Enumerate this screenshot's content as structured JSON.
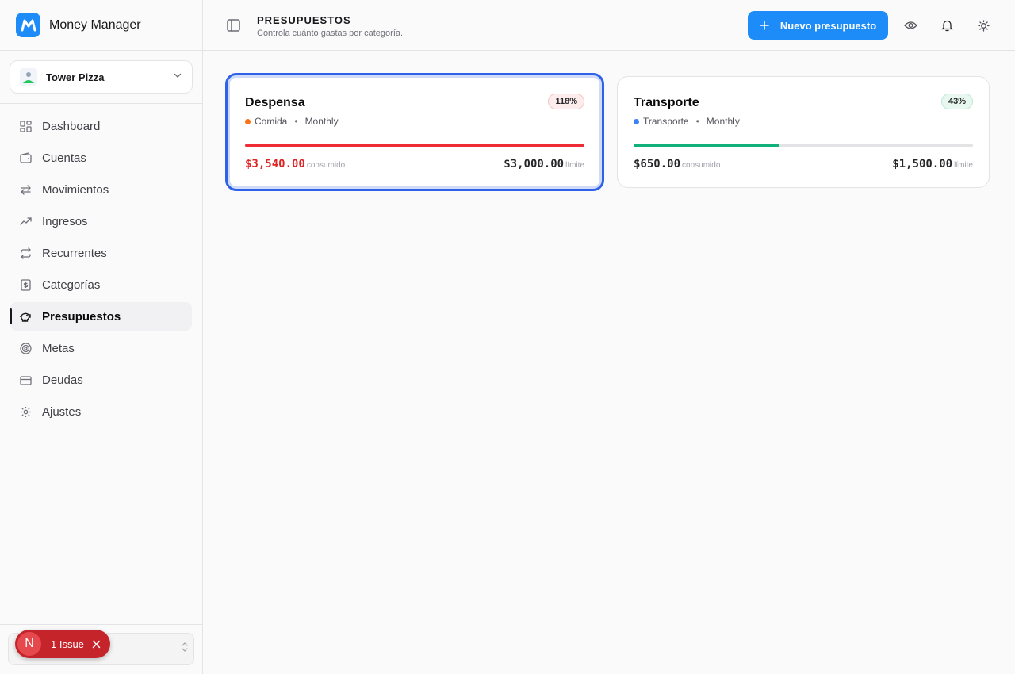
{
  "app": {
    "name": "Money Manager"
  },
  "org": {
    "name": "Tower Pizza"
  },
  "nav": [
    {
      "label": "Dashboard",
      "icon": "layout-grid-icon",
      "active": false
    },
    {
      "label": "Cuentas",
      "icon": "wallet-icon",
      "active": false
    },
    {
      "label": "Movimientos",
      "icon": "arrows-left-right-icon",
      "active": false
    },
    {
      "label": "Ingresos",
      "icon": "trending-up-icon",
      "active": false
    },
    {
      "label": "Recurrentes",
      "icon": "repeat-icon",
      "active": false
    },
    {
      "label": "Categorías",
      "icon": "receipt-icon",
      "active": false
    },
    {
      "label": "Presupuestos",
      "icon": "piggy-bank-icon",
      "active": true
    },
    {
      "label": "Metas",
      "icon": "target-icon",
      "active": false
    },
    {
      "label": "Deudas",
      "icon": "credit-card-icon",
      "active": false
    },
    {
      "label": "Ajustes",
      "icon": "gear-icon",
      "active": false
    }
  ],
  "header": {
    "title": "PRESUPUESTOS",
    "subtitle": "Controla cuánto gastas por categoría.",
    "new_button": "Nuevo presupuesto"
  },
  "issue": {
    "avatar": "N",
    "label": "1 Issue"
  },
  "budgets": [
    {
      "name": "Despensa",
      "category": "Comida",
      "period": "Monthly",
      "dot_color": "#f97316",
      "percent": "118%",
      "fill_fraction": 1.0,
      "fill_color": "#ef2b36",
      "spent": "$3,540.00",
      "spent_label": "consumido",
      "limit": "$3,000.00",
      "limit_label": "límite",
      "over": true
    },
    {
      "name": "Transporte",
      "category": "Transporte",
      "period": "Monthly",
      "dot_color": "#3b82f6",
      "percent": "43%",
      "fill_fraction": 0.43,
      "fill_color": "#12b07a",
      "spent": "$650.00",
      "spent_label": "consumido",
      "limit": "$1,500.00",
      "limit_label": "límite",
      "over": false
    }
  ]
}
